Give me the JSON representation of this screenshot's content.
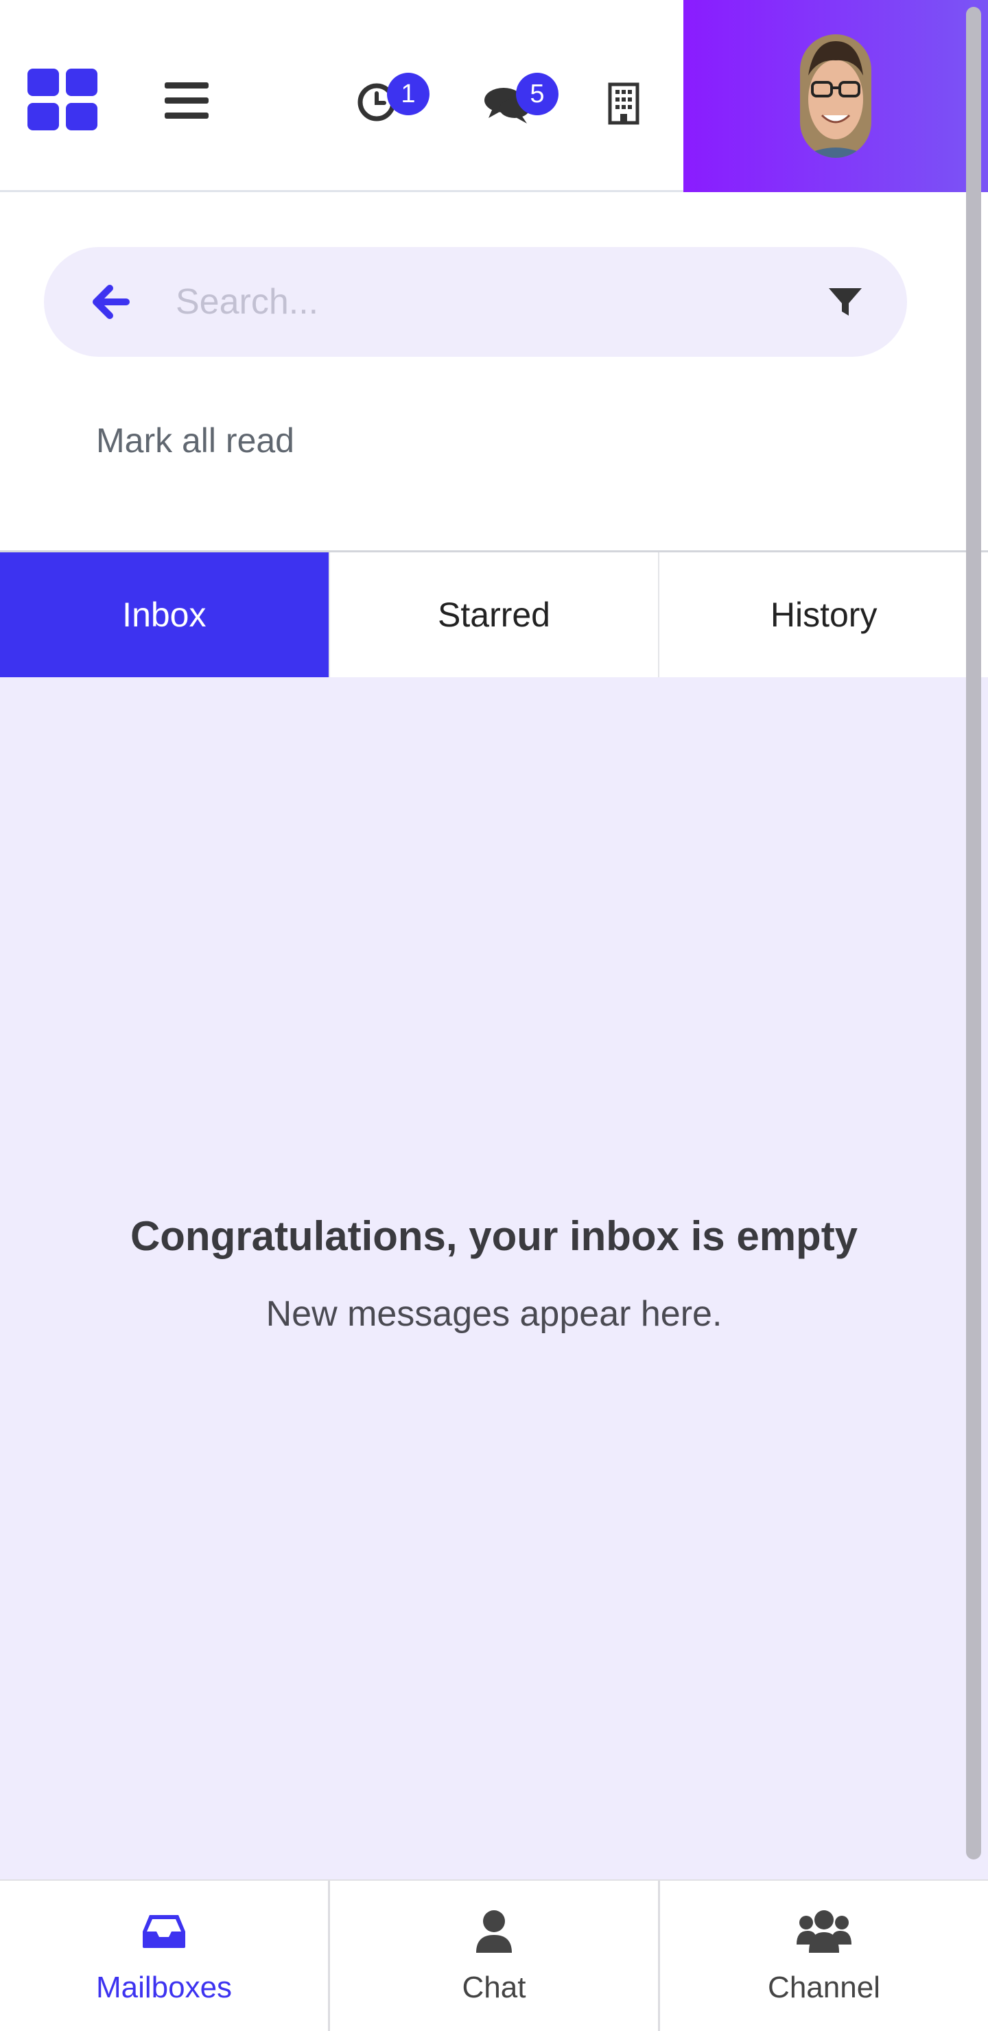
{
  "header": {
    "apps_icon": "grid-apps-icon",
    "menu_icon": "hamburger-menu-icon",
    "reminders": {
      "icon": "clock-icon",
      "count": "1"
    },
    "messages": {
      "icon": "chat-bubbles-icon",
      "count": "5"
    },
    "organization_icon": "building-icon",
    "profile_gradient": [
      "#8a1cff",
      "#7a55f5"
    ]
  },
  "search": {
    "placeholder": "Search...",
    "value": "",
    "back_icon": "arrow-left-icon",
    "filter_icon": "filter-icon"
  },
  "actions": {
    "mark_all_read": "Mark all read"
  },
  "tabs": [
    {
      "label": "Inbox",
      "active": true
    },
    {
      "label": "Starred",
      "active": false
    },
    {
      "label": "History",
      "active": false
    }
  ],
  "empty_state": {
    "title": "Congratulations, your inbox is empty",
    "subtitle": "New messages appear here."
  },
  "bottom_nav": [
    {
      "label": "Mailboxes",
      "icon": "inbox-tray-icon",
      "active": true
    },
    {
      "label": "Chat",
      "icon": "user-icon",
      "active": false
    },
    {
      "label": "Channel",
      "icon": "users-group-icon",
      "active": false
    }
  ],
  "colors": {
    "accent": "#3d33f0",
    "background_tint": "#efecfd"
  }
}
